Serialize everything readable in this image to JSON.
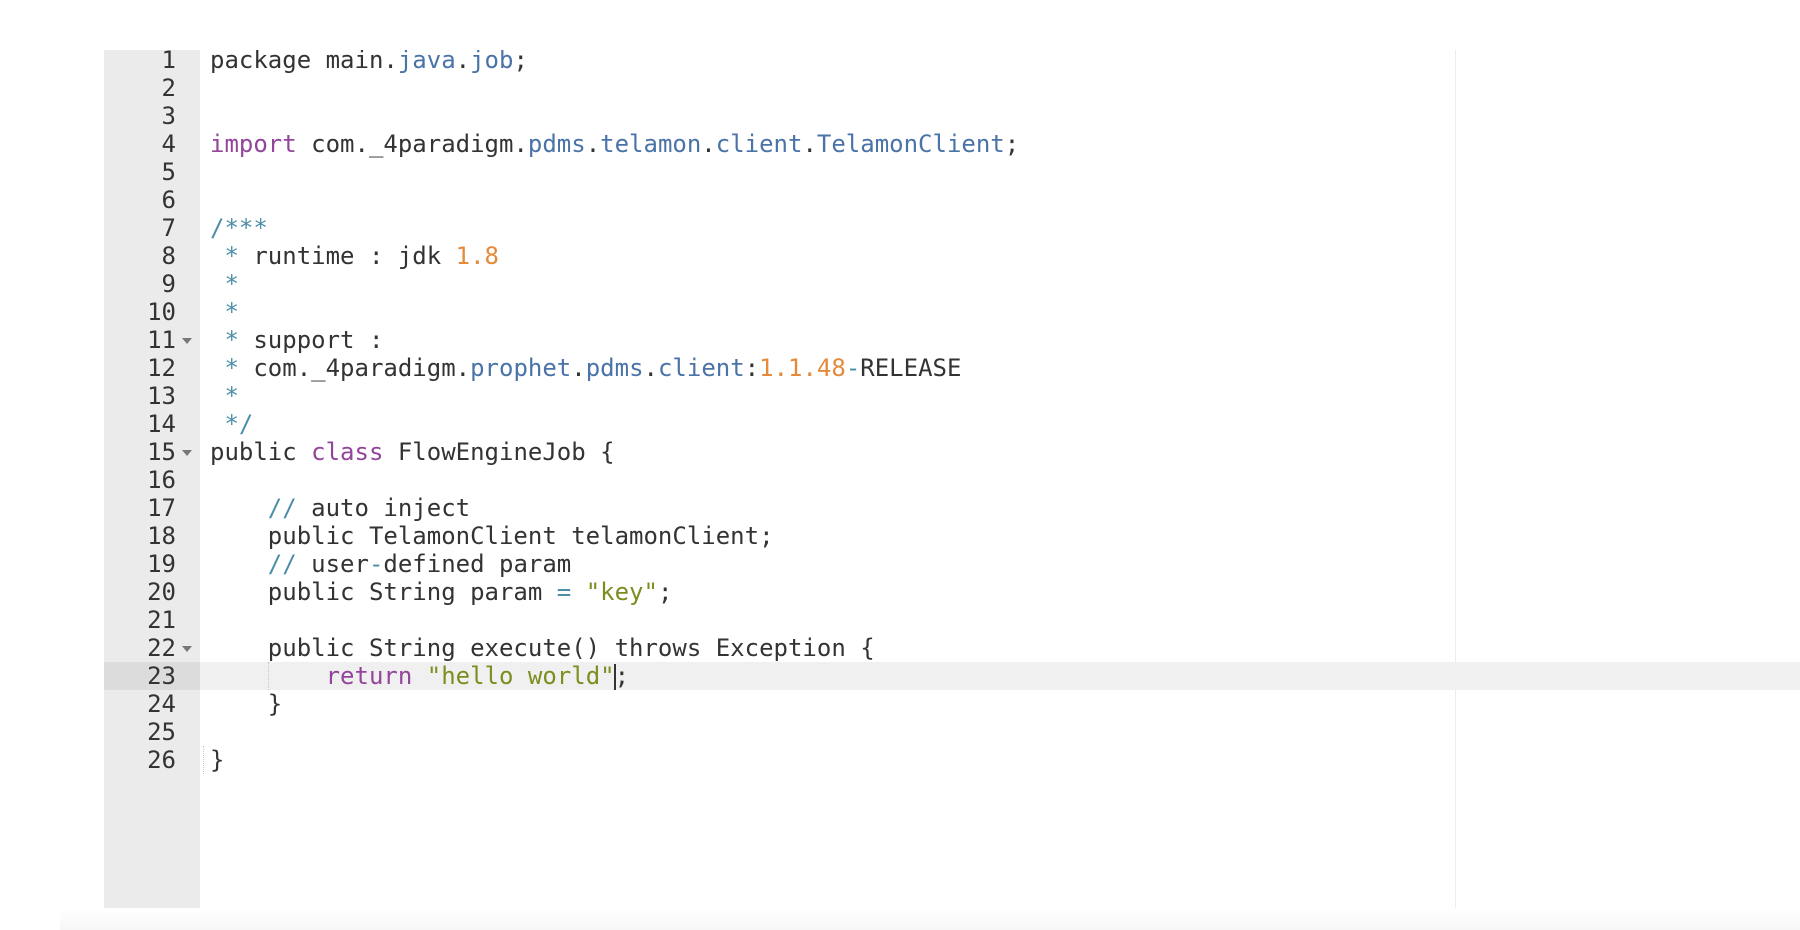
{
  "editor": {
    "active_line": 23,
    "fold_lines": [
      11,
      15,
      22
    ],
    "lines": [
      {
        "n": "1",
        "tokens": [
          {
            "c": "plain",
            "t": "package main."
          },
          {
            "c": "pkg",
            "t": "java"
          },
          {
            "c": "plain",
            "t": "."
          },
          {
            "c": "pkg",
            "t": "job"
          },
          {
            "c": "plain",
            "t": ";"
          }
        ]
      },
      {
        "n": "2",
        "tokens": []
      },
      {
        "n": "3",
        "tokens": []
      },
      {
        "n": "4",
        "tokens": [
          {
            "c": "kw",
            "t": "import"
          },
          {
            "c": "plain",
            "t": " com._4paradigm."
          },
          {
            "c": "pkg",
            "t": "pdms"
          },
          {
            "c": "plain",
            "t": "."
          },
          {
            "c": "pkg",
            "t": "telamon"
          },
          {
            "c": "plain",
            "t": "."
          },
          {
            "c": "pkg",
            "t": "client"
          },
          {
            "c": "plain",
            "t": "."
          },
          {
            "c": "pkg",
            "t": "TelamonClient"
          },
          {
            "c": "plain",
            "t": ";"
          }
        ]
      },
      {
        "n": "5",
        "tokens": []
      },
      {
        "n": "6",
        "tokens": []
      },
      {
        "n": "7",
        "tokens": [
          {
            "c": "cmt",
            "t": "/***"
          }
        ]
      },
      {
        "n": "8",
        "tokens": [
          {
            "c": "cmt",
            "t": " * "
          },
          {
            "c": "plain",
            "t": "runtime : jdk "
          },
          {
            "c": "num",
            "t": "1.8"
          }
        ]
      },
      {
        "n": "9",
        "tokens": [
          {
            "c": "cmt",
            "t": " *"
          }
        ]
      },
      {
        "n": "10",
        "tokens": [
          {
            "c": "cmt",
            "t": " *"
          }
        ]
      },
      {
        "n": "11",
        "tokens": [
          {
            "c": "cmt",
            "t": " * "
          },
          {
            "c": "plain",
            "t": "support :"
          }
        ]
      },
      {
        "n": "12",
        "tokens": [
          {
            "c": "cmt",
            "t": " * "
          },
          {
            "c": "plain",
            "t": "com._4paradigm."
          },
          {
            "c": "pkg",
            "t": "prophet"
          },
          {
            "c": "plain",
            "t": "."
          },
          {
            "c": "pkg",
            "t": "pdms"
          },
          {
            "c": "plain",
            "t": "."
          },
          {
            "c": "pkg",
            "t": "client"
          },
          {
            "c": "plain",
            "t": ":"
          },
          {
            "c": "num",
            "t": "1.1.48"
          },
          {
            "c": "op",
            "t": "-"
          },
          {
            "c": "plain",
            "t": "RELEASE"
          }
        ]
      },
      {
        "n": "13",
        "tokens": [
          {
            "c": "cmt",
            "t": " *"
          }
        ]
      },
      {
        "n": "14",
        "tokens": [
          {
            "c": "cmt",
            "t": " */"
          }
        ]
      },
      {
        "n": "15",
        "tokens": [
          {
            "c": "plain",
            "t": "public "
          },
          {
            "c": "kw",
            "t": "class"
          },
          {
            "c": "plain",
            "t": " FlowEngineJob {"
          }
        ]
      },
      {
        "n": "16",
        "tokens": []
      },
      {
        "n": "17",
        "tokens": [
          {
            "c": "plain",
            "t": "    "
          },
          {
            "c": "cmt",
            "t": "// "
          },
          {
            "c": "plain",
            "t": "auto inject"
          }
        ]
      },
      {
        "n": "18",
        "tokens": [
          {
            "c": "plain",
            "t": "    public TelamonClient telamonClient;"
          }
        ]
      },
      {
        "n": "19",
        "tokens": [
          {
            "c": "plain",
            "t": "    "
          },
          {
            "c": "cmt",
            "t": "// "
          },
          {
            "c": "plain",
            "t": "user"
          },
          {
            "c": "op",
            "t": "-"
          },
          {
            "c": "plain",
            "t": "defined param"
          }
        ]
      },
      {
        "n": "20",
        "tokens": [
          {
            "c": "plain",
            "t": "    public String param "
          },
          {
            "c": "op",
            "t": "="
          },
          {
            "c": "plain",
            "t": " "
          },
          {
            "c": "str",
            "t": "\"key\""
          },
          {
            "c": "plain",
            "t": ";"
          }
        ]
      },
      {
        "n": "21",
        "tokens": []
      },
      {
        "n": "22",
        "tokens": [
          {
            "c": "plain",
            "t": "    public String execute() throws Exception {"
          }
        ]
      },
      {
        "n": "23",
        "tokens": [
          {
            "c": "plain",
            "t": "        "
          },
          {
            "c": "kw",
            "t": "return"
          },
          {
            "c": "plain",
            "t": " "
          },
          {
            "c": "str",
            "t": "\"hello world\""
          },
          {
            "c": "cursor",
            "t": ""
          },
          {
            "c": "plain",
            "t": ";"
          }
        ]
      },
      {
        "n": "24",
        "tokens": [
          {
            "c": "plain",
            "t": "    }"
          }
        ]
      },
      {
        "n": "25",
        "tokens": []
      },
      {
        "n": "26",
        "tokens": [
          {
            "c": "plain",
            "t": "}"
          }
        ]
      }
    ]
  }
}
